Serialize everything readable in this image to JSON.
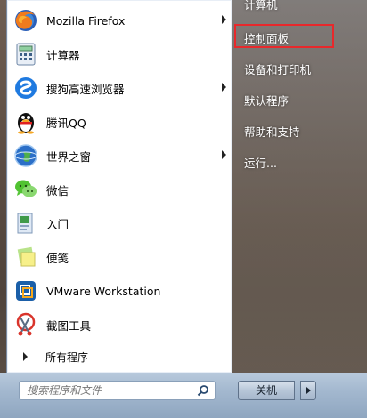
{
  "programs": [
    {
      "label": "Mozilla Firefox",
      "icon": "firefox-icon",
      "submenu": true
    },
    {
      "label": "计算器",
      "icon": "calculator-icon",
      "submenu": false
    },
    {
      "label": "搜狗高速浏览器",
      "icon": "sogou-browser-icon",
      "submenu": true
    },
    {
      "label": "腾讯QQ",
      "icon": "qq-penguin-icon",
      "submenu": false
    },
    {
      "label": "世界之窗",
      "icon": "theworld-browser-icon",
      "submenu": true
    },
    {
      "label": "微信",
      "icon": "wechat-icon",
      "submenu": false
    },
    {
      "label": "入门",
      "icon": "getting-started-icon",
      "submenu": false
    },
    {
      "label": "便笺",
      "icon": "sticky-notes-icon",
      "submenu": false
    },
    {
      "label": "VMware Workstation",
      "icon": "vmware-icon",
      "submenu": false
    },
    {
      "label": "截图工具",
      "icon": "snipping-tool-icon",
      "submenu": false
    }
  ],
  "all_programs_label": "所有程序",
  "search": {
    "placeholder": "搜索程序和文件"
  },
  "right_items": [
    {
      "label": "计算机"
    },
    {
      "label": "控制面板"
    },
    {
      "label": "设备和打印机"
    },
    {
      "label": "默认程序"
    },
    {
      "label": "帮助和支持"
    },
    {
      "label": "运行..."
    }
  ],
  "shutdown_label": "关机",
  "highlight_color": "#e8282b"
}
